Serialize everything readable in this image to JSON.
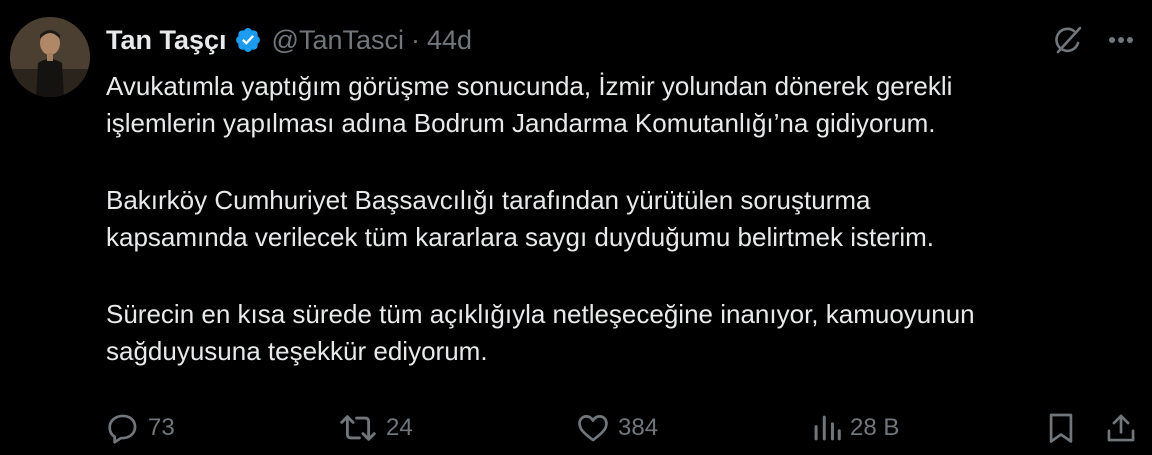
{
  "tweet": {
    "display_name": "Tan Taşçı",
    "handle": "@TanTasci",
    "separator": "·",
    "time": "44d",
    "paragraphs": [
      "Avukatımla yaptığım görüşme sonucunda, İzmir yolundan dönerek gerekli\nişlemlerin yapılması adına Bodrum Jandarma Komutanlığı’na gidiyorum.",
      "Bakırköy Cumhuriyet Başsavcılığı tarafından yürütülen soruşturma\nkapsamında verilecek tüm kararlara saygı duyduğumu belirtmek isterim.",
      "Sürecin en kısa sürede tüm açıklığıyla netleşeceğine inanıyor, kamuoyunun\nsağduyusuna teşekkür ediyorum."
    ]
  },
  "actions": {
    "replies": "73",
    "reposts": "24",
    "likes": "384",
    "views": "28 B"
  },
  "icons": {
    "verified": "verified-badge-icon",
    "grok": "grok-icon",
    "more": "more-icon",
    "reply": "reply-icon",
    "repost": "repost-icon",
    "like": "heart-icon",
    "views": "views-chart-icon",
    "bookmark": "bookmark-icon",
    "share": "share-icon"
  },
  "colors": {
    "background": "#000000",
    "text": "#e7e9ea",
    "secondary": "#71767b",
    "verified": "#1d9bf0"
  }
}
